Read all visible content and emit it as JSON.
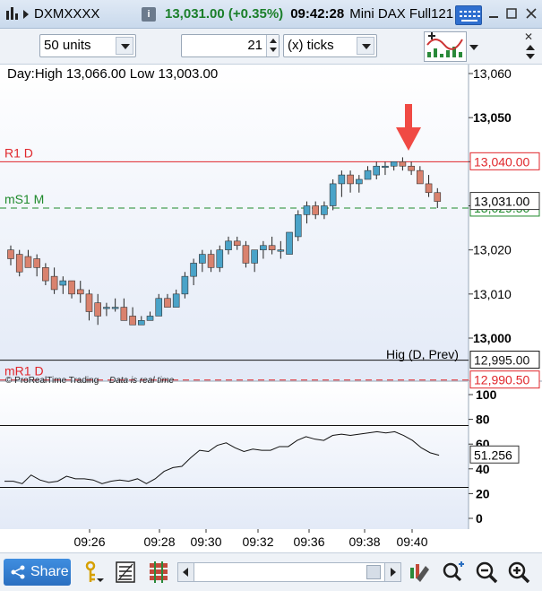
{
  "window": {
    "symbol": "DXMXXXX",
    "info_label": "i",
    "price_change": "13,031.00 (+0.35%)",
    "time": "09:42:28",
    "instrument_name": "Mini DAX Full121"
  },
  "toolbar": {
    "units_value": "50 units",
    "ticks_value": "21",
    "ticks_unit": "(x) ticks"
  },
  "price_chart": {
    "day_info": "Day:High 13,066.00 Low 13,003.00",
    "levels": [
      {
        "label": "R1 D",
        "value": "13,040.00",
        "color": "#e0262b"
      },
      {
        "label": "mS1 M",
        "value": "13,029.50",
        "color": "#1f8a2c"
      },
      {
        "label": "mR1 D",
        "value": "12,990.50",
        "color": "#e0262b"
      }
    ],
    "high_prev_label": "Hig (D, Prev)",
    "high_prev_value": "12,995.00",
    "current_price": "13,031.00",
    "y_ticks": [
      "13,060",
      "13,050",
      "13,040",
      "13,030",
      "13,020",
      "13,010",
      "13,000"
    ],
    "copyright": "© ProRealTime Trading",
    "realtime": "Data is real time",
    "up_color": "#4aa3c8",
    "down_color": "#d9826e"
  },
  "chart_data": {
    "type": "candlestick",
    "ylim": [
      12995,
      13066
    ],
    "candles": [
      [
        13020.0,
        13021.0,
        13016.5,
        13018.0
      ],
      [
        13019.0,
        13020.0,
        13014.0,
        13015.0
      ],
      [
        13018.5,
        13020.0,
        13016.0,
        13016.0
      ],
      [
        13018.0,
        13019.0,
        13014.0,
        13016.0
      ],
      [
        13016.0,
        13017.0,
        13012.0,
        13013.0
      ],
      [
        13014.0,
        13016.0,
        13010.0,
        13011.0
      ],
      [
        13012.0,
        13014.0,
        13010.0,
        13013.0
      ],
      [
        13013.0,
        13013.0,
        13009.0,
        13010.0
      ],
      [
        13011.0,
        13013.0,
        13008.0,
        13010.0
      ],
      [
        13010.0,
        13011.0,
        13004.0,
        13006.0
      ],
      [
        13008.0,
        13010.0,
        13003.0,
        13005.0
      ],
      [
        13007.0,
        13008.0,
        13005.0,
        13007.0
      ],
      [
        13007.0,
        13009.0,
        13006.0,
        13007.0
      ],
      [
        13007.0,
        13009.0,
        13004.0,
        13004.0
      ],
      [
        13005.0,
        13007.0,
        13003.0,
        13003.0
      ],
      [
        13003.0,
        13005.0,
        13003.0,
        13004.0
      ],
      [
        13004.0,
        13006.0,
        13004.0,
        13005.0
      ],
      [
        13005.0,
        13010.0,
        13005.0,
        13009.0
      ],
      [
        13009.0,
        13010.0,
        13007.0,
        13007.0
      ],
      [
        13007.0,
        13011.0,
        13007.0,
        13010.0
      ],
      [
        13010.0,
        13015.0,
        13009.0,
        13014.0
      ],
      [
        13014.0,
        13018.0,
        13012.0,
        13017.0
      ],
      [
        13017.0,
        13020.0,
        13015.0,
        13019.0
      ],
      [
        13019.0,
        13020.0,
        13015.0,
        13016.0
      ],
      [
        13016.0,
        13021.0,
        13015.0,
        13020.0
      ],
      [
        13020.0,
        13023.0,
        13019.0,
        13022.0
      ],
      [
        13022.0,
        13023.0,
        13020.0,
        13021.0
      ],
      [
        13021.0,
        13022.0,
        13016.0,
        13017.0
      ],
      [
        13017.0,
        13020.0,
        13015.0,
        13020.0
      ],
      [
        13020.0,
        13022.0,
        13018.0,
        13021.0
      ],
      [
        13021.0,
        13023.0,
        13019.0,
        13020.0
      ],
      [
        13020.0,
        13022.0,
        13018.0,
        13020.0
      ],
      [
        13019.0,
        13024.0,
        13019.0,
        13024.0
      ],
      [
        13023.0,
        13029.0,
        13022.0,
        13028.0
      ],
      [
        13028.0,
        13031.0,
        13026.0,
        13030.0
      ],
      [
        13030.0,
        13031.0,
        13027.0,
        13028.0
      ],
      [
        13028.0,
        13031.0,
        13027.0,
        13030.0
      ],
      [
        13030.0,
        13036.0,
        13029.0,
        13035.0
      ],
      [
        13035.0,
        13038.0,
        13032.0,
        13037.0
      ],
      [
        13037.0,
        13038.0,
        13033.0,
        13035.0
      ],
      [
        13035.0,
        13037.0,
        13033.0,
        13036.0
      ],
      [
        13036.0,
        13039.0,
        13036.0,
        13038.0
      ],
      [
        13037.0,
        13040.0,
        13036.0,
        13039.0
      ],
      [
        13039.0,
        13040.0,
        13037.0,
        13039.0
      ],
      [
        13039.0,
        13040.0,
        13038.0,
        13040.0
      ],
      [
        13040.0,
        13041.0,
        13038.0,
        13039.0
      ],
      [
        13039.0,
        13040.0,
        13037.0,
        13038.0
      ],
      [
        13038.0,
        13039.0,
        13035.0,
        13035.0
      ],
      [
        13035.0,
        13037.0,
        13032.0,
        13033.0
      ],
      [
        13033.0,
        13034.0,
        13029.5,
        13031.0
      ]
    ]
  },
  "oscillator": {
    "value": "51.256",
    "y_ticks": [
      "100",
      "80",
      "60",
      "40",
      "20",
      "0"
    ],
    "values": [
      30,
      30,
      28,
      35,
      31,
      29,
      30,
      34,
      32,
      32,
      31,
      28,
      30,
      31,
      30,
      32,
      28,
      32,
      38,
      41,
      42,
      49,
      55,
      54,
      59,
      61,
      57,
      54,
      56,
      55,
      55,
      58,
      58,
      63,
      66,
      64,
      63,
      67,
      68,
      67,
      68,
      69,
      70,
      69,
      70,
      67,
      63,
      57,
      53,
      51
    ]
  },
  "x_axis": {
    "labels": [
      "09:26",
      "09:28",
      "09:30",
      "09:32",
      "09:36",
      "09:38",
      "09:40"
    ]
  },
  "bottom_bar": {
    "share_label": "Share"
  }
}
